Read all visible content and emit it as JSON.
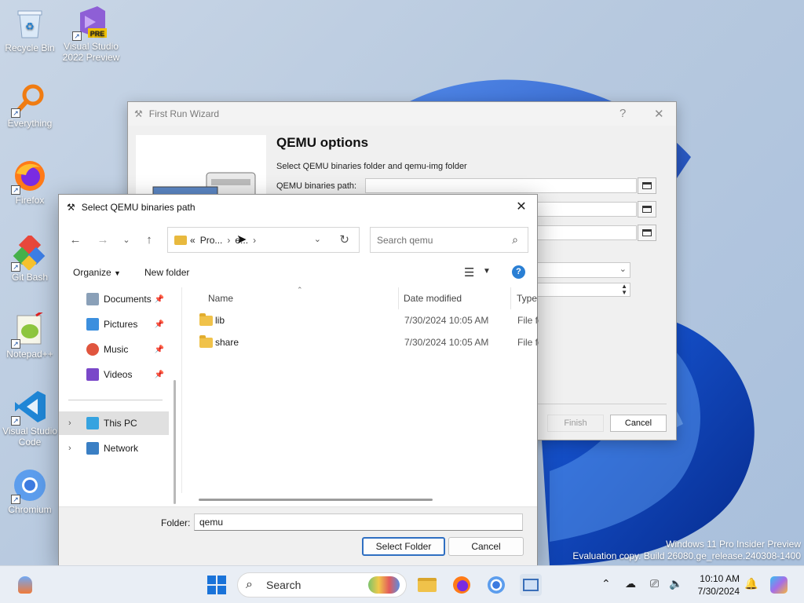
{
  "desktop": {
    "icons": [
      {
        "label": "Recycle Bin",
        "icon": "recycle-bin-icon"
      },
      {
        "label": "Visual Studio 2022 Preview",
        "line1": "Visual Studio",
        "line2": "2022 Preview",
        "icon": "visual-studio-preview-icon",
        "badge": "PRE"
      },
      {
        "label": "Everything",
        "icon": "everything-search-icon"
      },
      {
        "label": "Firefox",
        "icon": "firefox-icon"
      },
      {
        "label": "Git Bash",
        "icon": "git-bash-icon"
      },
      {
        "label": "Notepad++",
        "icon": "notepad-plus-plus-icon"
      },
      {
        "label": "Visual Studio Code",
        "line1": "Visual Studio",
        "line2": "Code",
        "icon": "vscode-icon"
      },
      {
        "label": "Chromium",
        "icon": "chromium-icon"
      }
    ]
  },
  "wizard": {
    "title": "First Run Wizard",
    "help": "?",
    "close": "✕",
    "heading": "QEMU options",
    "subtitle": "Select QEMU binaries folder and qemu-img folder",
    "binaries_label": "QEMU binaries path:",
    "finish": "Finish",
    "cancel": "Cancel"
  },
  "dialog": {
    "title": "Select QEMU binaries path",
    "address": {
      "prefix": "«",
      "crumbs": [
        "Pro...",
        "e..."
      ]
    },
    "search_placeholder": "Search qemu",
    "organize": "Organize",
    "new_folder": "New folder",
    "help": "?",
    "nav": [
      {
        "label": "Documents",
        "icon": "documents-icon",
        "pinned": true
      },
      {
        "label": "Pictures",
        "icon": "pictures-icon",
        "pinned": true
      },
      {
        "label": "Music",
        "icon": "music-icon",
        "pinned": true
      },
      {
        "label": "Videos",
        "icon": "videos-icon",
        "pinned": true
      },
      {
        "label": "This PC",
        "icon": "this-pc-icon",
        "selected": true
      },
      {
        "label": "Network",
        "icon": "network-icon"
      }
    ],
    "columns": {
      "name": "Name",
      "date": "Date modified",
      "type": "Type"
    },
    "rows": [
      {
        "name": "lib",
        "date": "7/30/2024 10:05 AM",
        "type": "File folder"
      },
      {
        "name": "share",
        "date": "7/30/2024 10:05 AM",
        "type": "File folder"
      }
    ],
    "folder_label": "Folder:",
    "folder_value": "qemu",
    "select_button": "Select Folder",
    "cancel_button": "Cancel"
  },
  "watermark": {
    "line1": "Windows 11 Pro Insider Preview",
    "line2": "Evaluation copy. Build 26080.ge_release.240308-1400"
  },
  "taskbar": {
    "search": "Search",
    "time": "10:10 AM",
    "date": "7/30/2024"
  },
  "colors": {
    "accent": "#2f6fc2",
    "folder": "#f0c24a",
    "taskbar": "#e9eef5"
  }
}
